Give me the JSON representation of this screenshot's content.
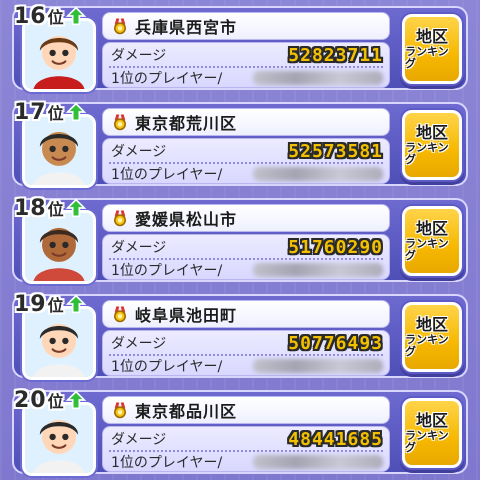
{
  "rows": [
    {
      "rank": "16",
      "rank_suffix": "位",
      "rank_trend_icon": "up-arrow-icon",
      "avatar_icon": "character-avatar",
      "region": "兵庫県西宮市",
      "damage_label": "ダメージ",
      "damage": "52823711",
      "top_player_label": "1位のプレイヤー/",
      "button_line1": "地区",
      "button_line2": "ランキング"
    },
    {
      "rank": "17",
      "rank_suffix": "位",
      "rank_trend_icon": "up-arrow-icon",
      "avatar_icon": "character-avatar",
      "region": "東京都荒川区",
      "damage_label": "ダメージ",
      "damage": "52573581",
      "top_player_label": "1位のプレイヤー/",
      "button_line1": "地区",
      "button_line2": "ランキング"
    },
    {
      "rank": "18",
      "rank_suffix": "位",
      "rank_trend_icon": "up-arrow-icon",
      "avatar_icon": "character-avatar",
      "region": "愛媛県松山市",
      "damage_label": "ダメージ",
      "damage": "51760290",
      "top_player_label": "1位のプレイヤー/",
      "button_line1": "地区",
      "button_line2": "ランキング"
    },
    {
      "rank": "19",
      "rank_suffix": "位",
      "rank_trend_icon": "up-arrow-icon",
      "avatar_icon": "character-avatar",
      "region": "岐阜県池田町",
      "damage_label": "ダメージ",
      "damage": "50776493",
      "top_player_label": "1位のプレイヤー/",
      "button_line1": "地区",
      "button_line2": "ランキング"
    },
    {
      "rank": "20",
      "rank_suffix": "位",
      "rank_trend_icon": "up-arrow-icon",
      "avatar_icon": "character-avatar",
      "region": "東京都品川区",
      "damage_label": "ダメージ",
      "damage": "48441685",
      "top_player_label": "1位のプレイヤー/",
      "button_line1": "地区",
      "button_line2": "ランキング"
    }
  ],
  "colors": {
    "background": "#8c86d6",
    "damage_text": "#f2c000",
    "button": "#f6b800",
    "trend_arrow": "#2fbf3a"
  }
}
